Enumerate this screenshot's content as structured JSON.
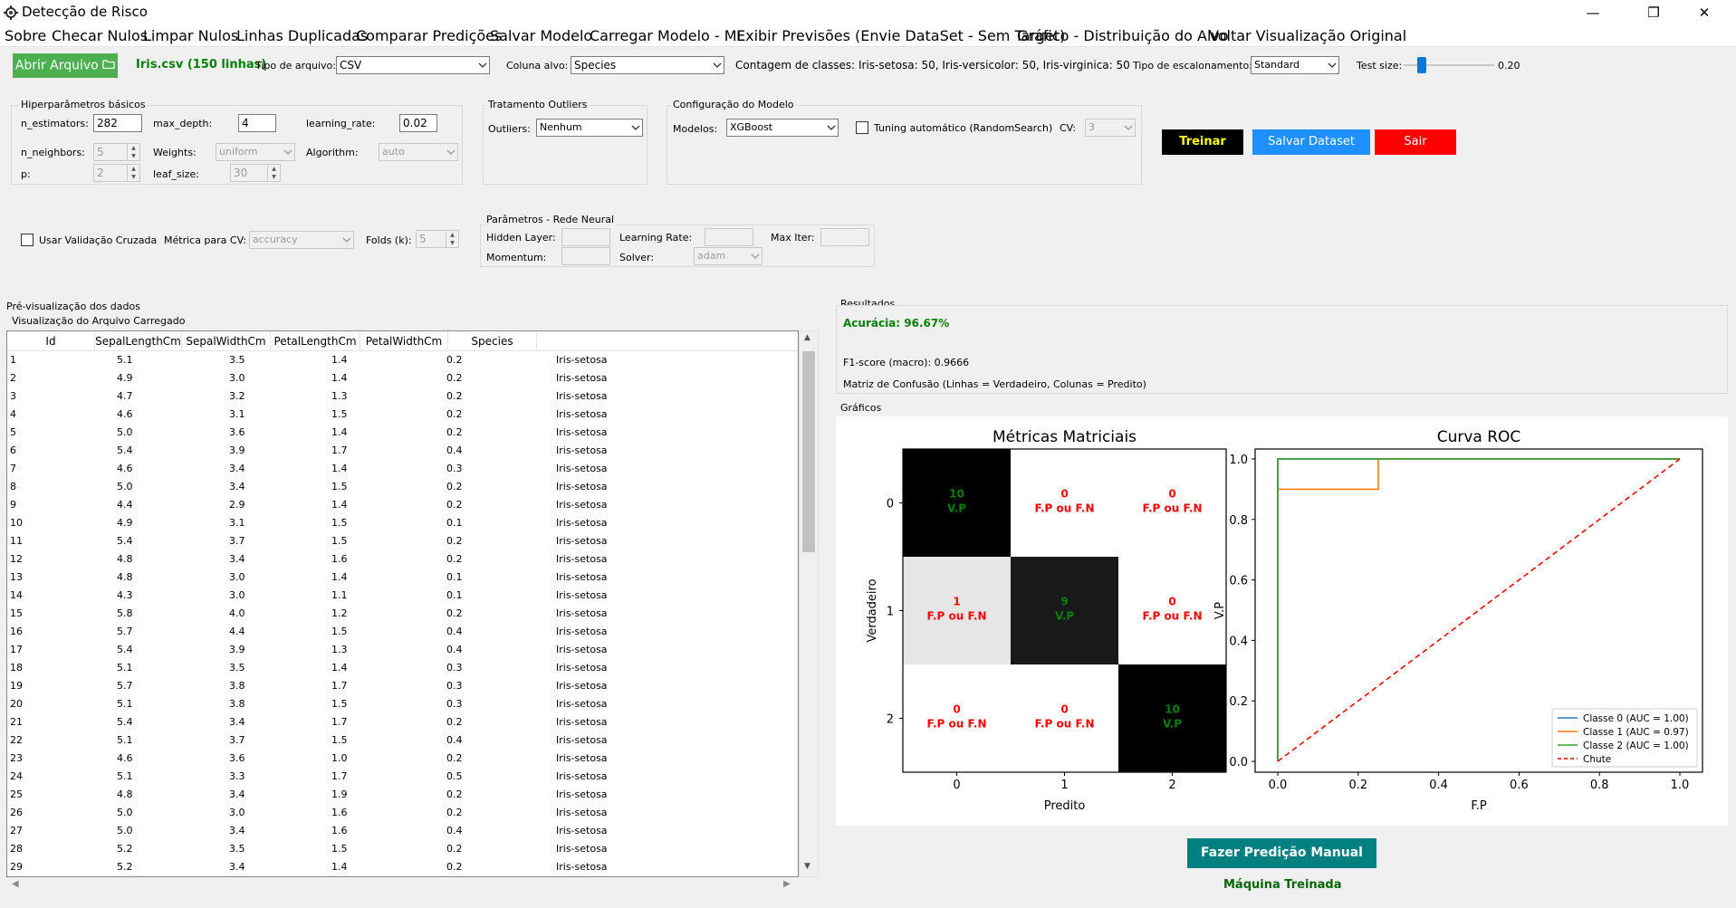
{
  "window": {
    "title": "Detecção de Risco",
    "minimize": "—",
    "maximize": "❐",
    "close": "✕"
  },
  "menu": [
    "Sobre",
    "Checar Nulos",
    "Limpar Nulos",
    "Linhas Duplicadas",
    "Comparar Predições",
    "Salvar Modelo",
    "Carregar Modelo - ML",
    "Exibir Previsões (Envie DataSet - Sem Target)",
    "Gráfico - Distribuição do Alvo",
    "Voltar Visualização Original"
  ],
  "toolbar": {
    "open_button": "Abrir Arquivo",
    "file_label": "Iris.csv (150 linhas)",
    "file_type_label": "Tipo de arquivo:",
    "file_type_value": "CSV",
    "target_label": "Coluna alvo:",
    "target_value": "Species",
    "class_count": "Contagem de classes: Iris-setosa: 50, Iris-versicolor: 50, Iris-virginica: 50",
    "scaling_label": "Tipo de escalonamento:",
    "scaling_value": "Standard",
    "test_size_label": "Test size:",
    "test_size_value": "0.20",
    "test_size_fraction": 0.2
  },
  "hyper": {
    "title": "Hiperparâmetros básicos",
    "n_estimators_label": "n_estimators:",
    "n_estimators": "282",
    "max_depth_label": "max_depth:",
    "max_depth": "4",
    "learning_rate_label": "learning_rate:",
    "learning_rate": "0.02",
    "n_neighbors_label": "n_neighbors:",
    "n_neighbors": "5",
    "weights_label": "Weights:",
    "weights": "uniform",
    "algorithm_label": "Algorithm:",
    "algorithm": "auto",
    "p_label": "p:",
    "p": "2",
    "leaf_size_label": "leaf_size:",
    "leaf_size": "30"
  },
  "outliers": {
    "title": "Tratamento Outliers",
    "label": "Outliers:",
    "value": "Nenhum"
  },
  "model_cfg": {
    "title": "Configuração do Modelo",
    "label": "Modelos:",
    "value": "XGBoost",
    "tuning_label": "Tuning automático (RandomSearch)",
    "cv_label": "CV:",
    "cv_value": "3"
  },
  "actions": {
    "train": "Treinar",
    "save_dataset": "Salvar Dataset",
    "exit": "Sair"
  },
  "cv": {
    "label": "Usar Validação Cruzada",
    "metric_label": "Métrica para CV:",
    "metric_value": "accuracy",
    "folds_label": "Folds (k):",
    "folds_value": "5"
  },
  "nn": {
    "title": "Parâmetros - Rede Neural",
    "hidden_label": "Hidden Layer:",
    "lr_label": "Learning Rate:",
    "max_iter_label": "Max Iter:",
    "momentum_label": "Momentum:",
    "solver_label": "Solver:",
    "solver_value": "adam"
  },
  "preview": {
    "title": "Pré-visualização dos dados",
    "subtitle": "Visualização do Arquivo Carregado",
    "columns": [
      "Id",
      "SepalLengthCm",
      "SepalWidthCm",
      "PetalLengthCm",
      "PetalWidthCm",
      "Species"
    ],
    "rows": [
      [
        "1",
        "5.1",
        "3.5",
        "1.4",
        "0.2",
        "Iris-setosa"
      ],
      [
        "2",
        "4.9",
        "3.0",
        "1.4",
        "0.2",
        "Iris-setosa"
      ],
      [
        "3",
        "4.7",
        "3.2",
        "1.3",
        "0.2",
        "Iris-setosa"
      ],
      [
        "4",
        "4.6",
        "3.1",
        "1.5",
        "0.2",
        "Iris-setosa"
      ],
      [
        "5",
        "5.0",
        "3.6",
        "1.4",
        "0.2",
        "Iris-setosa"
      ],
      [
        "6",
        "5.4",
        "3.9",
        "1.7",
        "0.4",
        "Iris-setosa"
      ],
      [
        "7",
        "4.6",
        "3.4",
        "1.4",
        "0.3",
        "Iris-setosa"
      ],
      [
        "8",
        "5.0",
        "3.4",
        "1.5",
        "0.2",
        "Iris-setosa"
      ],
      [
        "9",
        "4.4",
        "2.9",
        "1.4",
        "0.2",
        "Iris-setosa"
      ],
      [
        "10",
        "4.9",
        "3.1",
        "1.5",
        "0.1",
        "Iris-setosa"
      ],
      [
        "11",
        "5.4",
        "3.7",
        "1.5",
        "0.2",
        "Iris-setosa"
      ],
      [
        "12",
        "4.8",
        "3.4",
        "1.6",
        "0.2",
        "Iris-setosa"
      ],
      [
        "13",
        "4.8",
        "3.0",
        "1.4",
        "0.1",
        "Iris-setosa"
      ],
      [
        "14",
        "4.3",
        "3.0",
        "1.1",
        "0.1",
        "Iris-setosa"
      ],
      [
        "15",
        "5.8",
        "4.0",
        "1.2",
        "0.2",
        "Iris-setosa"
      ],
      [
        "16",
        "5.7",
        "4.4",
        "1.5",
        "0.4",
        "Iris-setosa"
      ],
      [
        "17",
        "5.4",
        "3.9",
        "1.3",
        "0.4",
        "Iris-setosa"
      ],
      [
        "18",
        "5.1",
        "3.5",
        "1.4",
        "0.3",
        "Iris-setosa"
      ],
      [
        "19",
        "5.7",
        "3.8",
        "1.7",
        "0.3",
        "Iris-setosa"
      ],
      [
        "20",
        "5.1",
        "3.8",
        "1.5",
        "0.3",
        "Iris-setosa"
      ],
      [
        "21",
        "5.4",
        "3.4",
        "1.7",
        "0.2",
        "Iris-setosa"
      ],
      [
        "22",
        "5.1",
        "3.7",
        "1.5",
        "0.4",
        "Iris-setosa"
      ],
      [
        "23",
        "4.6",
        "3.6",
        "1.0",
        "0.2",
        "Iris-setosa"
      ],
      [
        "24",
        "5.1",
        "3.3",
        "1.7",
        "0.5",
        "Iris-setosa"
      ],
      [
        "25",
        "4.8",
        "3.4",
        "1.9",
        "0.2",
        "Iris-setosa"
      ],
      [
        "26",
        "5.0",
        "3.0",
        "1.6",
        "0.2",
        "Iris-setosa"
      ],
      [
        "27",
        "5.0",
        "3.4",
        "1.6",
        "0.4",
        "Iris-setosa"
      ],
      [
        "28",
        "5.2",
        "3.5",
        "1.5",
        "0.2",
        "Iris-setosa"
      ],
      [
        "29",
        "5.2",
        "3.4",
        "1.4",
        "0.2",
        "Iris-setosa"
      ]
    ]
  },
  "results": {
    "title": "Resultados",
    "accuracy": "Acurácia: 96.67%",
    "f1": "F1-score (macro): 0.9666",
    "confusion_caption": "Matriz de Confusão (Linhas = Verdadeiro, Colunas = Predito)"
  },
  "graphs_title": "Gráficos",
  "chart_data": [
    {
      "type": "heatmap",
      "title": "Métricas Matriciais",
      "xlabel": "Predito",
      "ylabel": "Verdadeiro",
      "x_ticks": [
        "0",
        "1",
        "2"
      ],
      "y_ticks": [
        "0",
        "1",
        "2"
      ],
      "values": [
        [
          10,
          0,
          0
        ],
        [
          1,
          9,
          0
        ],
        [
          0,
          0,
          10
        ]
      ],
      "cell_labels": [
        [
          "V.P",
          "F.P ou F.N",
          "F.P ou F.N"
        ],
        [
          "F.P ou F.N",
          "V.P",
          "F.P ou F.N"
        ],
        [
          "F.P ou F.N",
          "F.P ou F.N",
          "V.P"
        ]
      ],
      "colors": {
        "diag_label": "#008000",
        "off_label": "#ff0000"
      }
    },
    {
      "type": "line",
      "title": "Curva ROC",
      "xlabel": "F.P",
      "ylabel": "V.P",
      "xlim": [
        0,
        1
      ],
      "ylim": [
        0,
        1
      ],
      "x_ticks": [
        "0.0",
        "0.2",
        "0.4",
        "0.6",
        "0.8",
        "1.0"
      ],
      "y_ticks": [
        "0.0",
        "0.2",
        "0.4",
        "0.6",
        "0.8",
        "1.0"
      ],
      "legend_position": "bottom-right",
      "series": [
        {
          "name": "Classe 0 (AUC = 1.00)",
          "color": "#1f77b4",
          "dash": false,
          "points": [
            [
              0,
              0
            ],
            [
              0,
              1
            ],
            [
              1,
              1
            ]
          ]
        },
        {
          "name": "Classe 1 (AUC = 0.97)",
          "color": "#ff7f0e",
          "dash": false,
          "points": [
            [
              0,
              0
            ],
            [
              0,
              0.9
            ],
            [
              0.25,
              0.9
            ],
            [
              0.25,
              1
            ],
            [
              1,
              1
            ]
          ]
        },
        {
          "name": "Classe 2 (AUC = 1.00)",
          "color": "#2ca02c",
          "dash": false,
          "points": [
            [
              0,
              0
            ],
            [
              0,
              1
            ],
            [
              1,
              1
            ]
          ]
        },
        {
          "name": "Chute",
          "color": "#ff0000",
          "dash": true,
          "points": [
            [
              0,
              0
            ],
            [
              1,
              1
            ]
          ]
        }
      ]
    }
  ],
  "manual_predict": "Fazer Predição Manual",
  "status": "Máquina Treinada",
  "colors": {
    "open_button": "#4caf50",
    "train": "#000000",
    "train_text": "#ffff00",
    "save_dataset": "#1e90ff",
    "exit": "#ff0000",
    "manual_predict": "#008080",
    "accent_green": "#008000"
  }
}
